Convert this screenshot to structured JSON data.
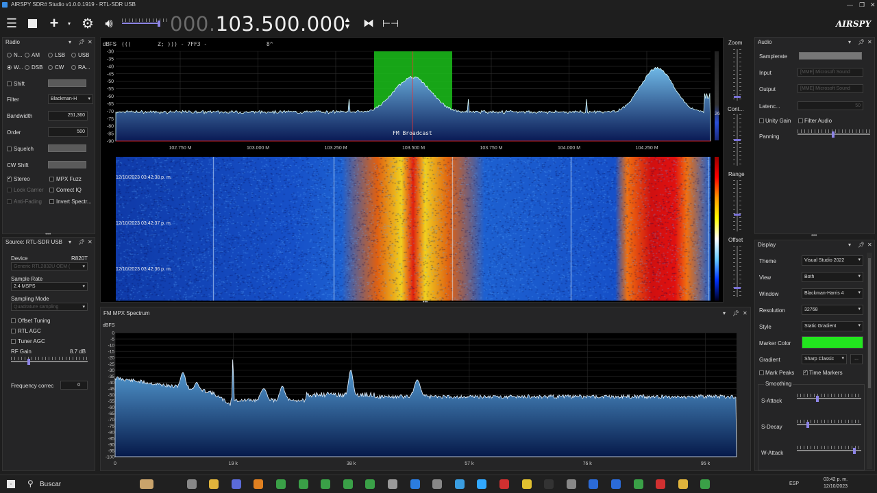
{
  "window": {
    "title": "AIRSPY SDR# Studio v1.0.0.1919 - RTL-SDR USB"
  },
  "toolbar": {
    "freq_dim": "000.",
    "freq_main": "103.500.000",
    "logo": "AIRSPY"
  },
  "radio": {
    "title": "Radio",
    "modes": [
      "N...",
      "AM",
      "LSB",
      "USB",
      "W...",
      "DSB",
      "CW",
      "RA..."
    ],
    "selected_mode": "W...",
    "shift_label": "Shift",
    "filter_label": "Filter",
    "filter_value": "Blackman-H",
    "bandwidth_label": "Bandwidth",
    "bandwidth_value": "251,360",
    "order_label": "Order",
    "order_value": "500",
    "squelch_label": "Squelch",
    "cwshift_label": "CW Shift",
    "stereo_label": "Stereo",
    "mpxfuzz_label": "MPX Fuzz",
    "lockcarrier_label": "Lock Carrier",
    "correctiq_label": "Correct IQ",
    "antifading_label": "Anti-Fading",
    "invert_label": "Invert Spectr..."
  },
  "source": {
    "title": "Source: RTL-SDR USB",
    "device_label": "Device",
    "device_value": "R820T",
    "device_select": "Generic RTL2832U OEM (",
    "samplerate_label": "Sample Rate",
    "samplerate_value": "2.4 MSPS",
    "sampling_label": "Sampling Mode",
    "sampling_value": "Quadrature sampling",
    "offset_label": "Offset Tuning",
    "rtlagc_label": "RTL AGC",
    "tuneragc_label": "Tuner AGC",
    "rfgain_label": "RF Gain",
    "rfgain_value": "8.7 dB",
    "freqcorr_label": "Frequency correc",
    "freqcorr_value": "0"
  },
  "spectrum": {
    "dbfs_label": "dBFS",
    "rds": "(((        Z; ))) - 7FF3 -                  8^",
    "y_ticks": [
      "-30",
      "-35",
      "-40",
      "-45",
      "-50",
      "-55",
      "-60",
      "-65",
      "-70",
      "-75",
      "-80",
      "-85",
      "-90"
    ],
    "x_ticks": [
      "102.750 M",
      "103.000 M",
      "103.250 M",
      "103.500 M",
      "103.750 M",
      "104.000 M",
      "104.250 M"
    ],
    "band_label": "FM Broadcast",
    "zoom_label": "Zoom",
    "contrast_label": "Cont...",
    "contrast_value": "26",
    "range_label": "Range",
    "offset_label": "Offset",
    "timestamps": [
      "12/10/2023 03:42:38 p. m.",
      "12/10/2023 03:42:37 p. m.",
      "12/10/2023 03:42:36 p. m."
    ]
  },
  "mpx": {
    "title": "FM MPX Spectrum",
    "dbfs_label": "dBFS",
    "y_ticks": [
      "0",
      "-5",
      "-10",
      "-15",
      "-20",
      "-25",
      "-30",
      "-35",
      "-40",
      "-45",
      "-50",
      "-55",
      "-60",
      "-65",
      "-70",
      "-75",
      "-80",
      "-85",
      "-90",
      "-95",
      "-100"
    ],
    "x_ticks": [
      "0",
      "19 k",
      "38 k",
      "57 k",
      "76 k",
      "95 k"
    ]
  },
  "audio": {
    "title": "Audio",
    "samplerate_label": "Samplerate",
    "input_label": "Input",
    "input_value": "[MME] Microsoft Sound",
    "output_label": "Output",
    "output_value": "[MME] Microsoft Sound",
    "latency_label": "Latenc...",
    "latency_value": "50",
    "unitygain_label": "Unity Gain",
    "filteraudio_label": "Filter Audio",
    "panning_label": "Panning"
  },
  "display": {
    "title": "Display",
    "theme_label": "Theme",
    "theme_value": "Visual Studio 2022",
    "view_label": "View",
    "view_value": "Both",
    "window_label": "Window",
    "window_value": "Blackman-Harris 4",
    "resolution_label": "Resolution",
    "resolution_value": "32768",
    "style_label": "Style",
    "style_value": "Static Gradient",
    "marker_label": "Marker Color",
    "marker_color": "#22e61e",
    "gradient_label": "Gradient",
    "gradient_value": "Sharp Classic",
    "gradient_btn": "...",
    "markpeaks_label": "Mark Peaks",
    "timemarkers_label": "Time Markers",
    "smoothing_label": "Smoothing",
    "sattack_label": "S-Attack",
    "sdecay_label": "S-Decay",
    "wattack_label": "W-Attack"
  },
  "taskbar": {
    "search": "Buscar",
    "lang": "ESP",
    "time": "03:42 p. m.",
    "date": "12/10/2023"
  }
}
